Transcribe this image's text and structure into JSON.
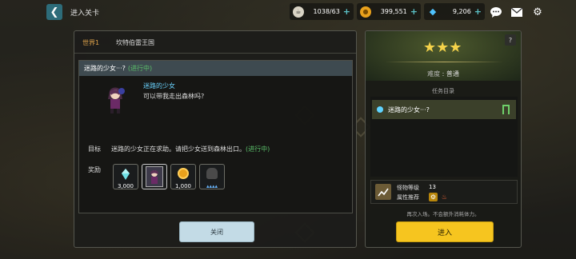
{
  "topbar": {
    "title": "进入关卡",
    "stamina": "1038/63",
    "gold": "399,551",
    "gems": "9,206"
  },
  "stage": {
    "world_label": "世界1",
    "world_name": "坎特伯雷王国"
  },
  "quest": {
    "title": "迷路的少女···?",
    "status": "(进行中)",
    "npc_name": "迷路的少女",
    "npc_line": "可以带我走出森林吗?",
    "goal_label": "目标",
    "goal_text": "迷路的少女正在求助。请把少女送到森林出口。",
    "goal_status": "(进行中)",
    "reward_label": "奖励",
    "rewards": [
      {
        "icon": "crystal-icon",
        "value": "3,000"
      },
      {
        "icon": "hero-card-icon",
        "value": ""
      },
      {
        "icon": "gold-coin-icon",
        "value": "1,000"
      },
      {
        "icon": "shadow-item-icon",
        "value": ""
      }
    ],
    "close_label": "关闭"
  },
  "detail": {
    "stars": "★★★",
    "difficulty_label": "难度",
    "difficulty_value": "普通",
    "task_list_title": "任务目录",
    "task_item": "迷路的少女···?",
    "monster_level_label": "怪物等级",
    "monster_level": "13",
    "attr_label": "属性推荐",
    "note": "再次入场。不会额外消耗体力。",
    "enter_label": "进入"
  },
  "colors": {
    "accent_yellow": "#f6c51f",
    "progress_green": "#5bbf6a",
    "npc_blue": "#6ad3ff",
    "world_orange": "#e0a34b"
  }
}
